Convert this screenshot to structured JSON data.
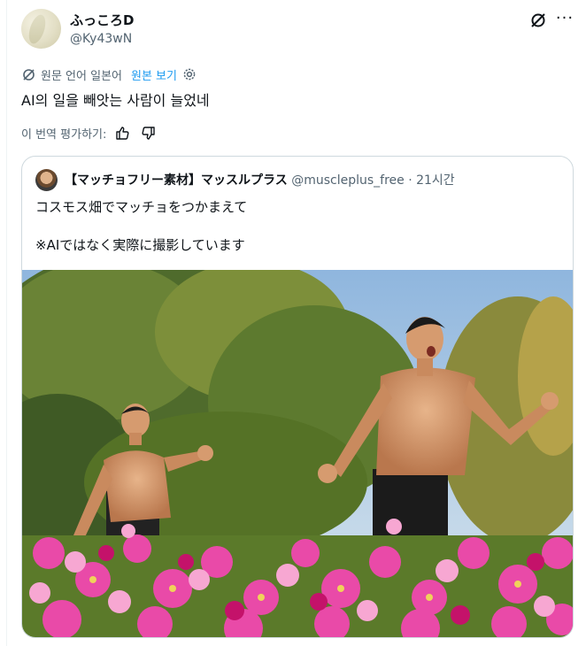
{
  "author": {
    "display_name": "ふっころD",
    "handle": "@Ky43wN"
  },
  "translate_bar": {
    "label": "원문 언어 일본어",
    "show_original": "원본 보기"
  },
  "post": {
    "text": "AI의 일을 빼앗는 사람이 늘었네"
  },
  "rate_bar": {
    "label": "이 번역 평가하기:"
  },
  "quoted_post": {
    "author_name": "【マッチョフリー素材】マッスルプラス",
    "handle": "@muscleplus_free",
    "separator": "·",
    "time": "21시간",
    "line1": "コスモス畑でマッチョをつかまえて",
    "line2": "※AIではなく実際に撮影しています",
    "photo_description": "two-shirtless-men-running-in-cosmos-flower-field"
  },
  "colors": {
    "text": "#0f1419",
    "secondary": "#536471",
    "link": "#1d9bf0",
    "border": "#cfd9de"
  }
}
